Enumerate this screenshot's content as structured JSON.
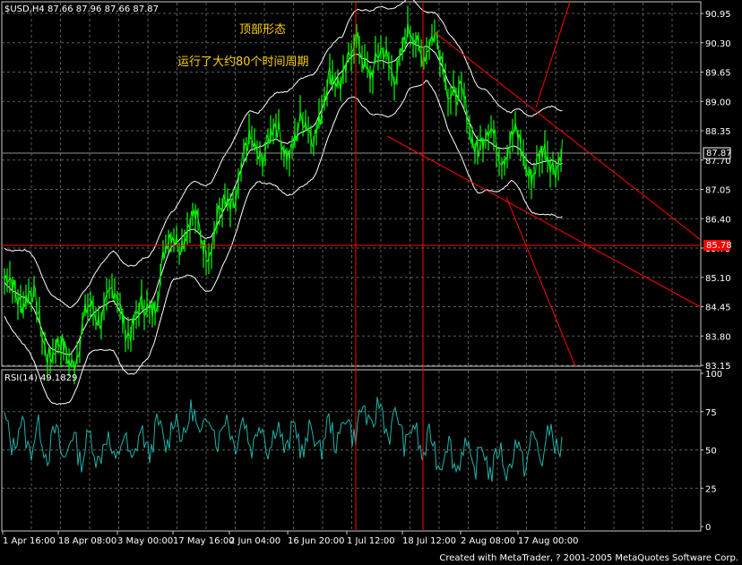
{
  "header": {
    "main": "$USD,H4  87.66 87.96 87.66 87.87",
    "rsi": "RSI(14)  49.1829"
  },
  "annotations": {
    "pattern": "顶部形态",
    "duration": "运行了大约80个时间周期"
  },
  "footer": "Created with MetaTrader, ? 2001-2005 MetaQuotes Software Corp.",
  "price_axis": {
    "ticks": [
      "90.95",
      "90.30",
      "89.65",
      "89.00",
      "88.35",
      "87.70",
      "87.05",
      "86.40",
      "85.75",
      "85.10",
      "84.45",
      "83.80",
      "83.15"
    ],
    "current": "87.87",
    "level_box": "85.78"
  },
  "rsi_axis": {
    "ticks": [
      "100",
      "75",
      "50",
      "25",
      "0"
    ]
  },
  "time_axis": {
    "labels": [
      "1 Apr 16:00",
      "18 Apr 08:00",
      "3 May 00:00",
      "17 May 16:00",
      "2 Jun 04:00",
      "16 Jun 20:00",
      "1 Jul 12:00",
      "18 Jul 12:00",
      "2 Aug 08:00",
      "17 Aug 00:00"
    ]
  },
  "colors": {
    "background": "#000000",
    "grid": "#5a5a5a",
    "candles": "#00ff00",
    "bands": "#ffffff",
    "rsi": "#20b2aa",
    "annotation": "#ffd200",
    "lines": "#ff0000"
  },
  "chart_data": [
    {
      "type": "line",
      "title": "$USD,H4",
      "ylim": [
        83.15,
        90.95
      ],
      "grid": true,
      "x": [
        "1 Apr 16:00",
        "18 Apr 08:00",
        "3 May 00:00",
        "17 May 16:00",
        "2 Jun 04:00",
        "16 Jun 20:00",
        "1 Jul 12:00",
        "18 Jul 12:00",
        "2 Aug 08:00",
        "17 Aug 00:00"
      ],
      "series": [
        {
          "values": [
            84.6,
            83.7,
            84.4,
            85.9,
            87.6,
            88.8,
            90.2,
            89.9,
            87.7,
            88.1
          ]
        }
      ],
      "levels": [
        85.78,
        87.87
      ]
    },
    {
      "type": "line",
      "title": "RSI(14)",
      "ylim": [
        0,
        100
      ],
      "x": [
        "1 Apr 16:00",
        "18 Apr 08:00",
        "3 May 00:00",
        "17 May 16:00",
        "2 Jun 04:00",
        "16 Jun 20:00",
        "1 Jul 12:00",
        "18 Jul 12:00",
        "2 Aug 08:00",
        "17 Aug 00:00"
      ],
      "series": [
        {
          "values": [
            62,
            52,
            50,
            68,
            60,
            56,
            73,
            48,
            42,
            58
          ]
        }
      ],
      "last": 49.1829
    }
  ]
}
